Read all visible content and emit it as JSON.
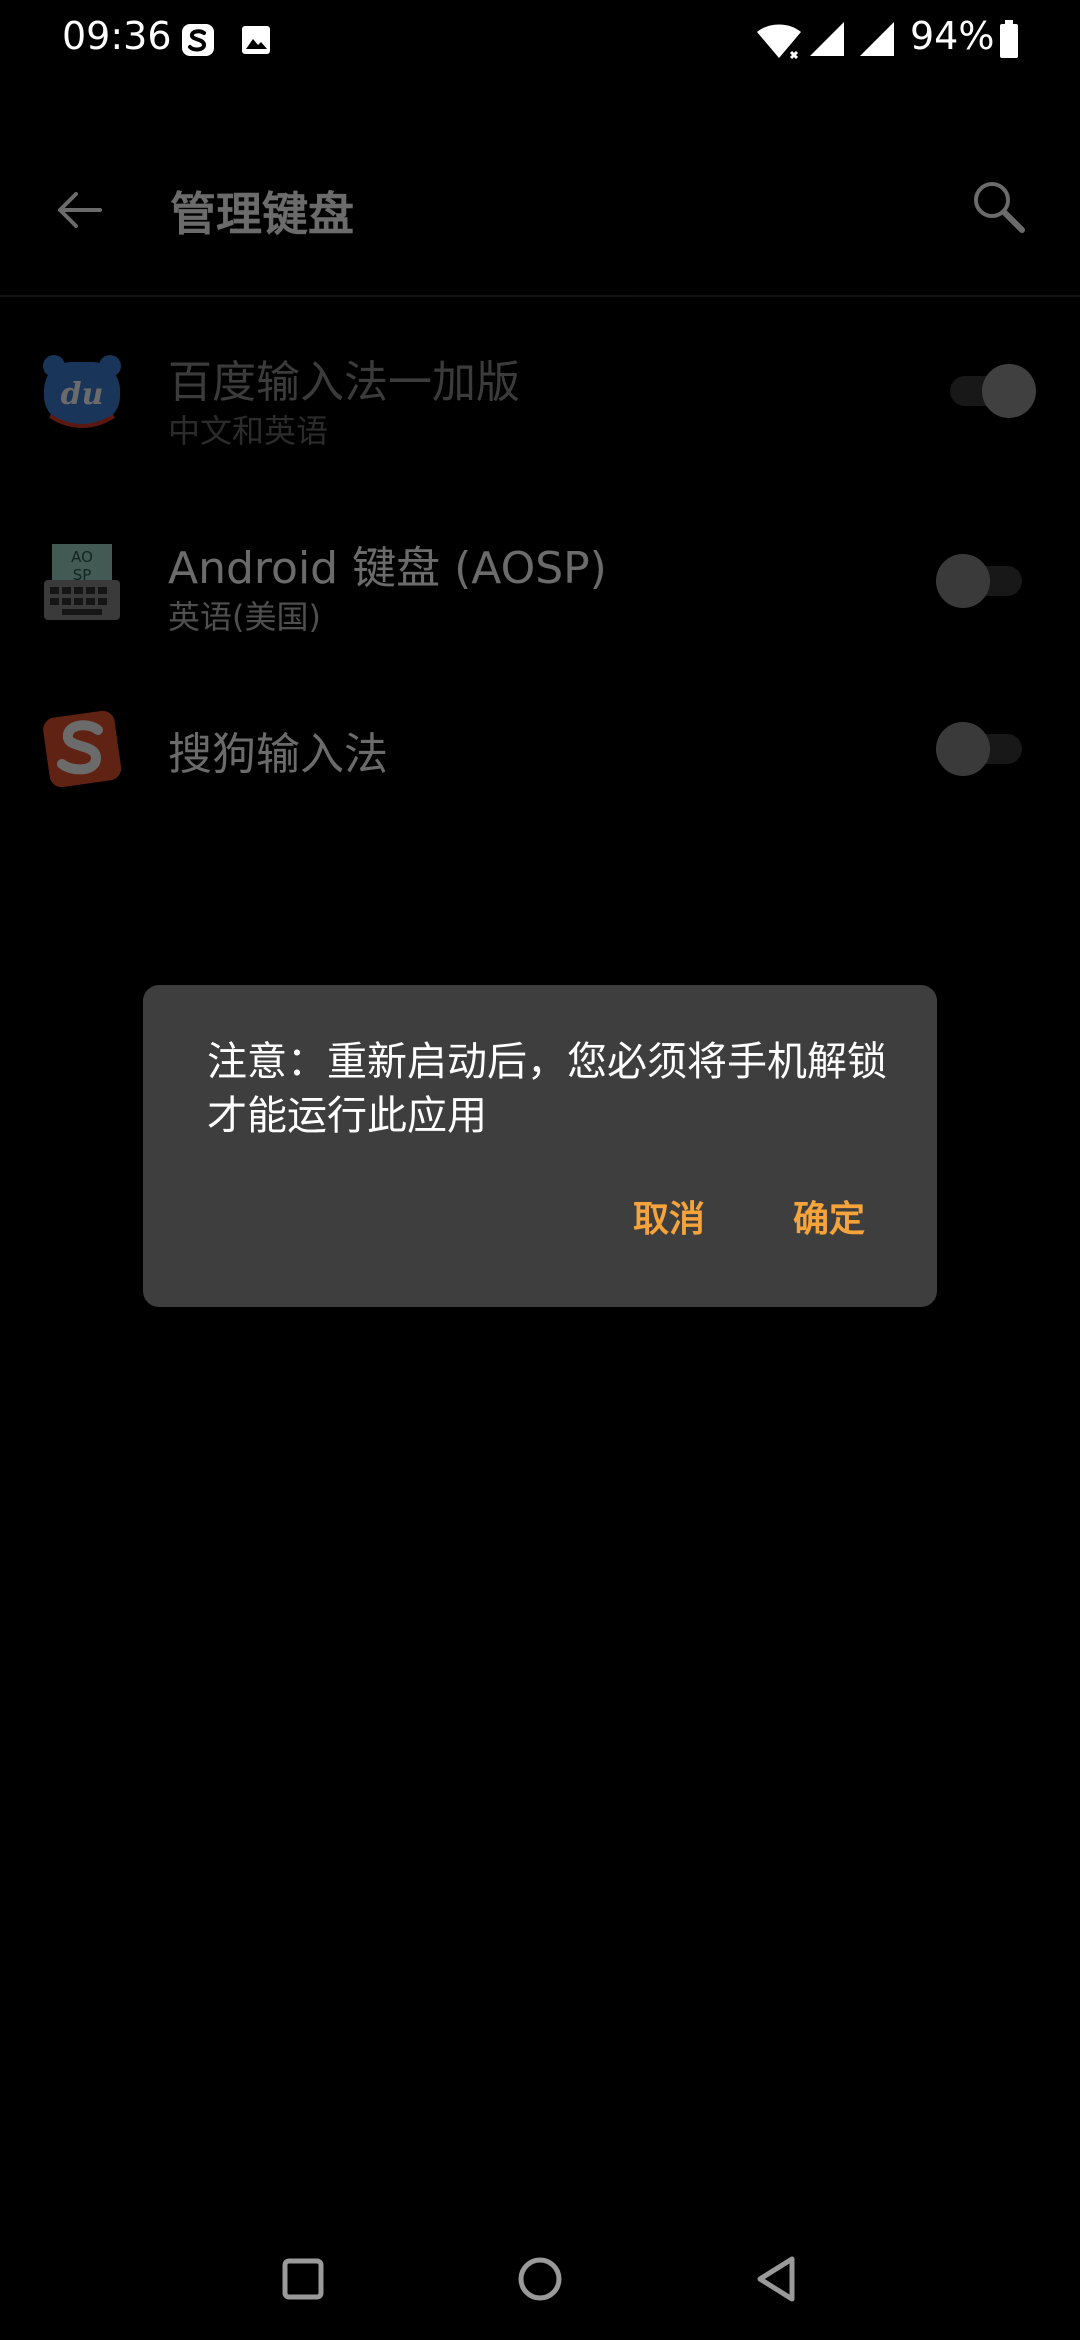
{
  "status_bar": {
    "time": "09:36",
    "battery": "94%",
    "icons": [
      "sogou-notification-icon",
      "image-notification-icon",
      "wifi-icon",
      "signal-icon",
      "signal-icon",
      "battery-icon"
    ]
  },
  "app_bar": {
    "title": "管理键盘",
    "back_icon": "arrow-left-icon",
    "search_icon": "search-icon"
  },
  "keyboards": [
    {
      "name": "百度输入法一加版",
      "subtitle": "中文和英语",
      "enabled": true,
      "icon": "baidu-du-icon"
    },
    {
      "name": "Android 键盘 (AOSP)",
      "subtitle": "英语(美国)",
      "enabled": false,
      "icon": "aosp-keyboard-icon"
    },
    {
      "name": "搜狗输入法",
      "subtitle": "",
      "enabled": false,
      "icon": "sogou-s-icon"
    }
  ],
  "dialog": {
    "message": "注意：重新启动后，您必须将手机解锁才能运行此应用",
    "cancel_label": "取消",
    "ok_label": "确定"
  },
  "colors": {
    "dialog_bg": "#3e3e3e",
    "accent": "#f5a33a",
    "background": "#000000"
  }
}
